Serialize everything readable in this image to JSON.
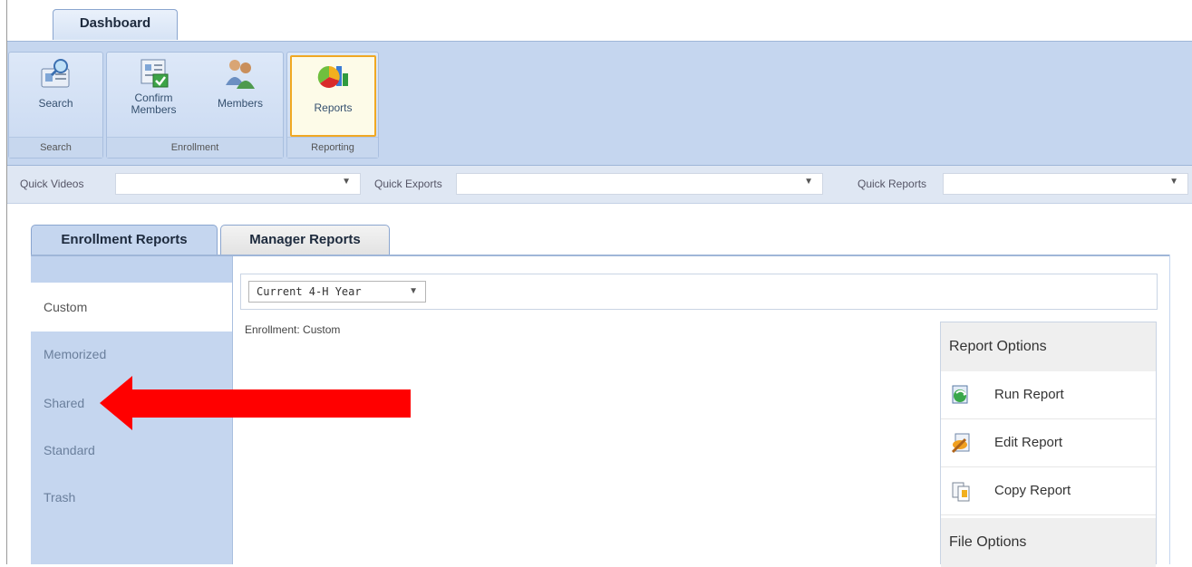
{
  "ribbon": {
    "tab": "Dashboard",
    "groups": [
      {
        "label": "Search",
        "buttons": [
          {
            "label": "Search",
            "icon": "search-card-icon"
          }
        ]
      },
      {
        "label": "Enrollment",
        "buttons": [
          {
            "label": "Confirm Members",
            "icon": "confirm-members-icon"
          },
          {
            "label": "Members",
            "icon": "members-icon"
          }
        ]
      },
      {
        "label": "Reporting",
        "buttons": [
          {
            "label": "Reports",
            "icon": "reports-chart-icon"
          }
        ]
      }
    ]
  },
  "quickbar": {
    "videos_label": "Quick Videos",
    "exports_label": "Quick Exports",
    "reports_label": "Quick Reports"
  },
  "reports": {
    "tabs": [
      "Enrollment Reports",
      "Manager Reports"
    ],
    "active_tab": "Enrollment Reports",
    "sidebar": [
      "Custom",
      "Memorized",
      "Shared",
      "Standard",
      "Trash"
    ],
    "selected_item": "Custom",
    "year_select": "Current 4-H Year",
    "breadcrumb": "Enrollment: Custom",
    "report_options_title": "Report Options",
    "report_options": [
      {
        "label": "Run Report",
        "icon": "run-report-icon"
      },
      {
        "label": "Edit Report",
        "icon": "edit-report-icon"
      },
      {
        "label": "Copy Report",
        "icon": "copy-report-icon"
      }
    ],
    "file_options_title": "File Options"
  },
  "annotation": {
    "color": "#ff0000",
    "points_to": "Shared"
  },
  "colors": {
    "ribbon_bg": "#c5d6ef",
    "active_button_border": "#f0a823",
    "accent_blue": "#8aa5cf"
  }
}
